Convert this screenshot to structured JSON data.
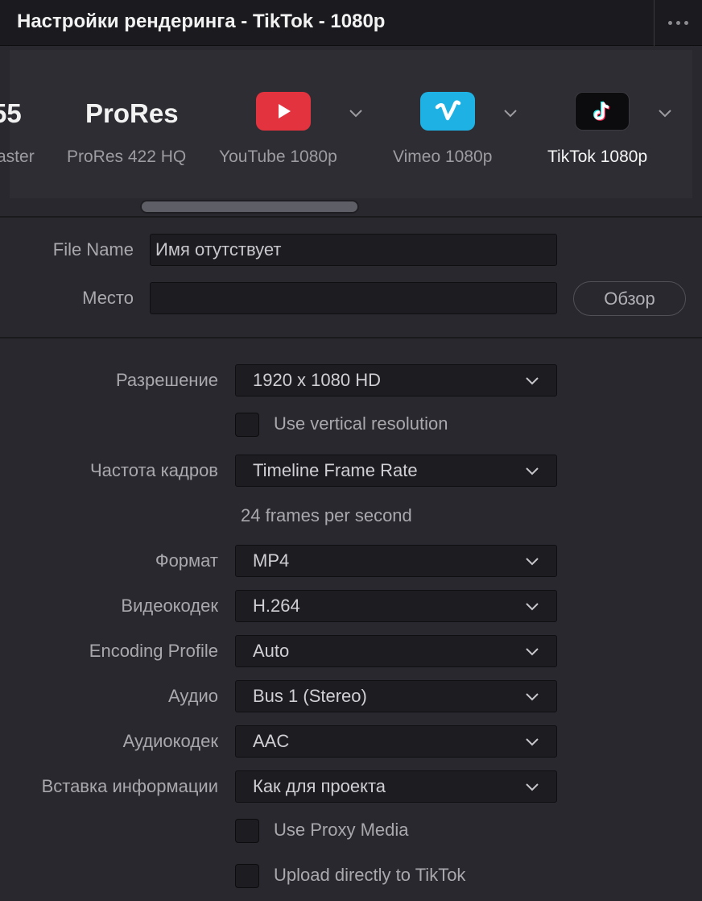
{
  "window": {
    "title": "Настройки рендеринга - TikTok - 1080p"
  },
  "presets": [
    {
      "big": "55",
      "caption": "aster"
    },
    {
      "big": "ProRes",
      "caption": "ProRes 422 HQ"
    },
    {
      "icon": "youtube-icon",
      "caption": "YouTube 1080p",
      "color": "#e3333f"
    },
    {
      "icon": "vimeo-icon",
      "caption": "Vimeo 1080p",
      "color": "#1eb2e4"
    },
    {
      "icon": "tiktok-icon",
      "caption": "TikTok 1080p",
      "color": "#0c0c0e",
      "active": true
    }
  ],
  "file": {
    "name_label": "File Name",
    "name_value": "Имя отутствует",
    "location_label": "Место",
    "location_value": "",
    "browse_label": "Обзор"
  },
  "settings": {
    "resolution_label": "Разрешение",
    "resolution_value": "1920 x 1080 HD",
    "vertical_label": "Use vertical resolution",
    "framerate_label": "Частота кадров",
    "framerate_value": "Timeline Frame Rate",
    "fps_note": "24 frames per second",
    "format_label": "Формат",
    "format_value": "MP4",
    "codec_label": "Видеокодек",
    "codec_value": "H.264",
    "profile_label": "Encoding Profile",
    "profile_value": "Auto",
    "audio_label": "Аудио",
    "audio_value": "Bus 1 (Stereo)",
    "audiocodec_label": "Аудиокодек",
    "audiocodec_value": "AAC",
    "metadata_label": "Вставка информации",
    "metadata_value": "Как для проекта",
    "proxy_label": "Use Proxy Media",
    "upload_label": "Upload directly to TikTok"
  }
}
